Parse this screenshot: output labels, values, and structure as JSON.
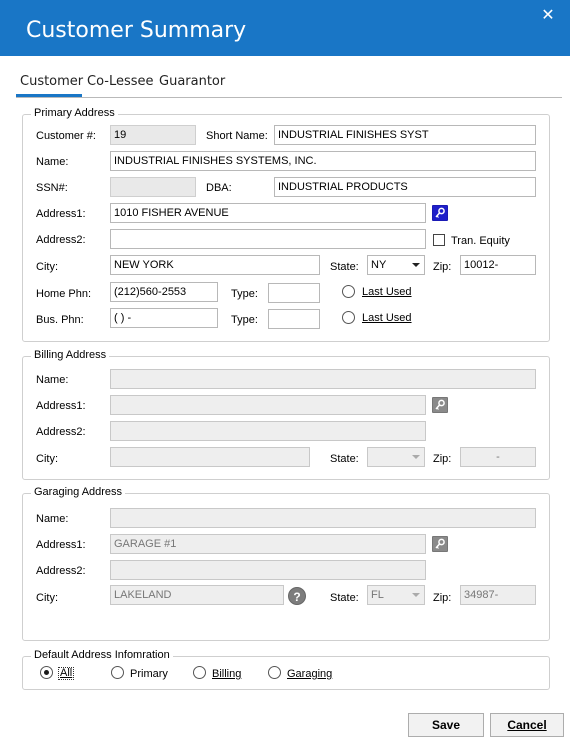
{
  "window": {
    "title": "Customer Summary",
    "close_glyph": "✕"
  },
  "tabs": [
    "Customer",
    "Co-Lessee",
    "Guarantor"
  ],
  "primary": {
    "title": "Primary Address",
    "customer_no_label": "Customer #:",
    "customer_no": "19",
    "short_name_label": "Short Name:",
    "short_name": "INDUSTRIAL FINISHES SYST",
    "name_label": "Name:",
    "name": "INDUSTRIAL FINISHES SYSTEMS, INC.",
    "ssn_label": "SSN#:",
    "ssn": "",
    "dba_label": "DBA:",
    "dba": "INDUSTRIAL PRODUCTS",
    "address1_label": "Address1:",
    "address1": "1010 FISHER AVENUE",
    "address2_label": "Address2:",
    "address2": "",
    "tran_equity_label": "Tran. Equity",
    "city_label": "City:",
    "city": "NEW YORK",
    "state_label": "State:",
    "state": "NY",
    "zip_label": "Zip:",
    "zip": "10012-",
    "home_phn_label": "Home Phn:",
    "home_phn": "(212)560-2553",
    "type_label": "Type:",
    "home_type": "",
    "last_used_label": "Last Used",
    "bus_phn_label": "Bus. Phn:",
    "bus_phn": "(  )  -",
    "bus_type": ""
  },
  "billing": {
    "title": "Billing Address",
    "name_label": "Name:",
    "name": "",
    "address1_label": "Address1:",
    "address1": "",
    "address2_label": "Address2:",
    "address2": "",
    "city_label": "City:",
    "city": "",
    "state_label": "State:",
    "state": "",
    "zip_label": "Zip:",
    "zip": "-"
  },
  "garaging": {
    "title": "Garaging Address",
    "name_label": "Name:",
    "name": "",
    "address1_label": "Address1:",
    "address1": "GARAGE #1",
    "address2_label": "Address2:",
    "address2": "",
    "city_label": "City:",
    "city": "LAKELAND",
    "help_glyph": "?",
    "state_label": "State:",
    "state": "FL",
    "zip_label": "Zip:",
    "zip": "34987-"
  },
  "default_address": {
    "title": "Default Address Infomration",
    "options": [
      "All",
      "Primary",
      "Billing",
      "Garaging"
    ],
    "selected": "All"
  },
  "buttons": {
    "save": "Save",
    "cancel": "Cancel"
  }
}
